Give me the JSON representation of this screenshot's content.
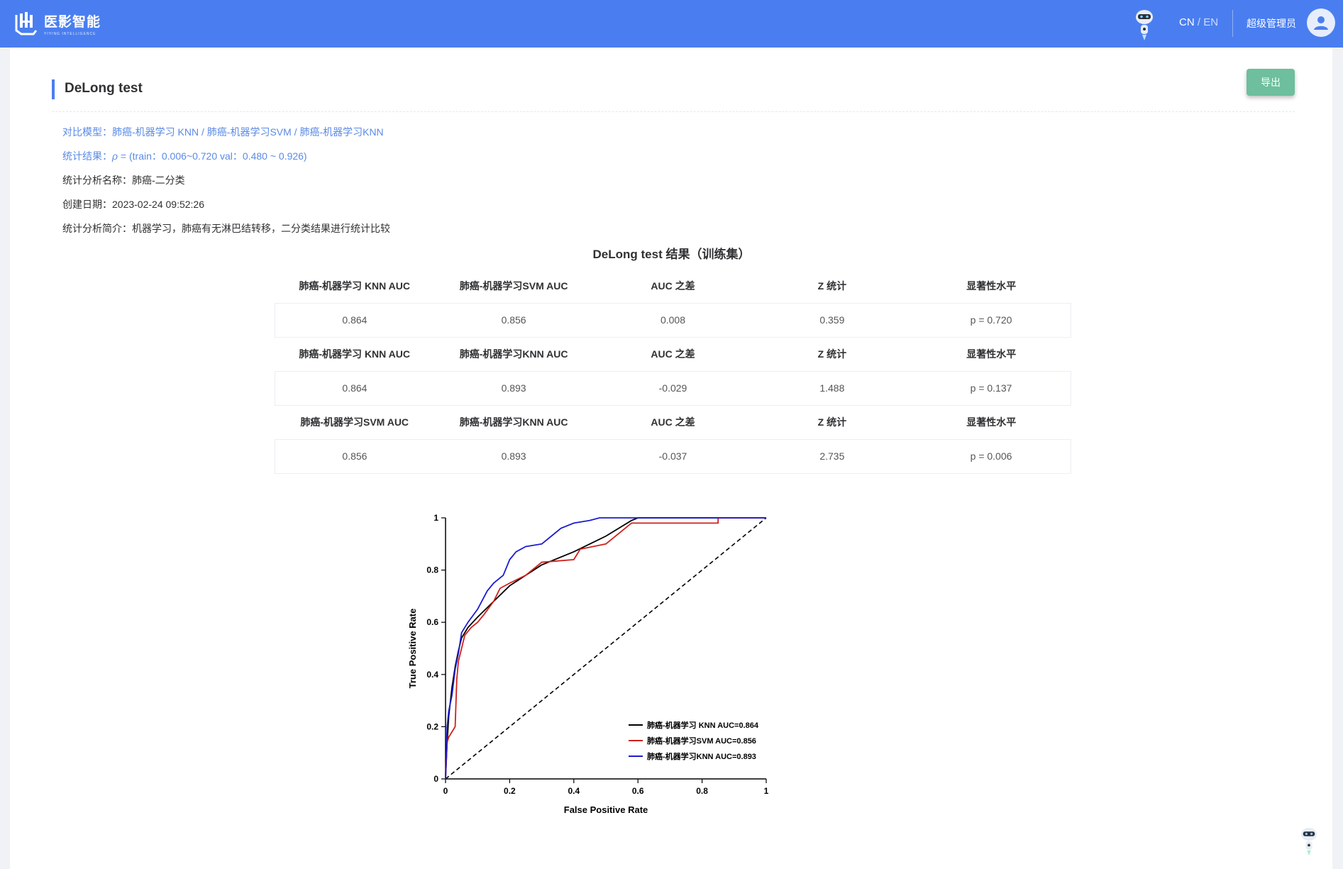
{
  "header": {
    "logo_title": "医影智能",
    "logo_subtitle": "YIYING INTELLIGENCE",
    "lang_cn": "CN",
    "lang_sep": "/",
    "lang_en": "EN",
    "user_name": "超级管理员"
  },
  "colors": {
    "header": "#4a7ef0",
    "export": "#6dbf9d",
    "link_text": "#5a8ae6"
  },
  "section": {
    "title": "DeLong test",
    "export_label": "导出"
  },
  "info": {
    "models": "对比模型：肺癌-机器学习 KNN / 肺癌-机器学习SVM / 肺癌-机器学习KNN",
    "result_prefix": "统计结果：",
    "result_symbol": "ρ",
    "result_text": " = (train：0.006~0.720 val：0.480 ~ 0.926)",
    "analysis_name": "统计分析名称：肺癌-二分类",
    "created": "创建日期：2023-02-24 09:52:26",
    "intro": "统计分析简介：机器学习，肺癌有无淋巴结转移，二分类结果进行统计比较"
  },
  "table": {
    "caption": "DeLong test 结果（训练集）",
    "groups": [
      {
        "headers": [
          "肺癌-机器学习 KNN AUC",
          "肺癌-机器学习SVM AUC",
          "AUC 之差",
          "Z 统计",
          "显著性水平"
        ],
        "values": [
          "0.864",
          "0.856",
          "0.008",
          "0.359",
          "p = 0.720"
        ]
      },
      {
        "headers": [
          "肺癌-机器学习 KNN AUC",
          "肺癌-机器学习KNN AUC",
          "AUC 之差",
          "Z 统计",
          "显著性水平"
        ],
        "values": [
          "0.864",
          "0.893",
          "-0.029",
          "1.488",
          "p = 0.137"
        ]
      },
      {
        "headers": [
          "肺癌-机器学习SVM AUC",
          "肺癌-机器学习KNN AUC",
          "AUC 之差",
          "Z 统计",
          "显著性水平"
        ],
        "values": [
          "0.856",
          "0.893",
          "-0.037",
          "2.735",
          "p = 0.006"
        ]
      }
    ]
  },
  "chart_data": {
    "type": "line",
    "title": "",
    "xlabel": "False Positive Rate",
    "ylabel": "True Positive Rate",
    "xlim": [
      0,
      1
    ],
    "ylim": [
      0,
      1
    ],
    "xticks": [
      "0",
      "0.2",
      "0.4",
      "0.6",
      "0.8",
      "1"
    ],
    "yticks": [
      "0",
      "0.2",
      "0.4",
      "0.6",
      "0.8",
      "1"
    ],
    "legend_position": "bottom-right",
    "grid": false,
    "series": [
      {
        "name": "肺癌-机器学习 KNN AUC=0.864",
        "color": "#000000",
        "x": [
          0,
          0.005,
          0.01,
          0.02,
          0.03,
          0.04,
          0.05,
          0.07,
          0.1,
          0.15,
          0.2,
          0.25,
          0.3,
          0.4,
          0.5,
          0.58,
          0.6,
          1
        ],
        "y": [
          0,
          0.14,
          0.24,
          0.35,
          0.43,
          0.49,
          0.54,
          0.58,
          0.62,
          0.68,
          0.74,
          0.78,
          0.82,
          0.87,
          0.93,
          0.99,
          1,
          1
        ]
      },
      {
        "name": "肺癌-机器学习SVM AUC=0.856",
        "color": "#d0201c",
        "x": [
          0,
          0.005,
          0.01,
          0.02,
          0.03,
          0.035,
          0.04,
          0.05,
          0.06,
          0.08,
          0.1,
          0.12,
          0.15,
          0.17,
          0.2,
          0.25,
          0.3,
          0.4,
          0.42,
          0.5,
          0.55,
          0.58,
          0.85,
          0.85,
          1
        ],
        "y": [
          0,
          0.14,
          0.16,
          0.18,
          0.2,
          0.38,
          0.45,
          0.5,
          0.55,
          0.58,
          0.6,
          0.63,
          0.68,
          0.73,
          0.75,
          0.78,
          0.83,
          0.84,
          0.88,
          0.9,
          0.95,
          0.98,
          0.98,
          1,
          1
        ]
      },
      {
        "name": "肺癌-机器学习KNN AUC=0.893",
        "color": "#1c1cd0",
        "x": [
          0,
          0.005,
          0.01,
          0.02,
          0.03,
          0.04,
          0.05,
          0.07,
          0.1,
          0.13,
          0.15,
          0.18,
          0.2,
          0.22,
          0.25,
          0.3,
          0.33,
          0.36,
          0.4,
          0.45,
          0.48,
          1
        ],
        "y": [
          0,
          0.2,
          0.26,
          0.32,
          0.42,
          0.48,
          0.56,
          0.6,
          0.65,
          0.72,
          0.75,
          0.78,
          0.84,
          0.87,
          0.89,
          0.9,
          0.93,
          0.96,
          0.98,
          0.99,
          1,
          1
        ]
      }
    ],
    "reference_line": {
      "x": [
        0,
        1
      ],
      "y": [
        0,
        1
      ],
      "style": "dashed"
    }
  }
}
